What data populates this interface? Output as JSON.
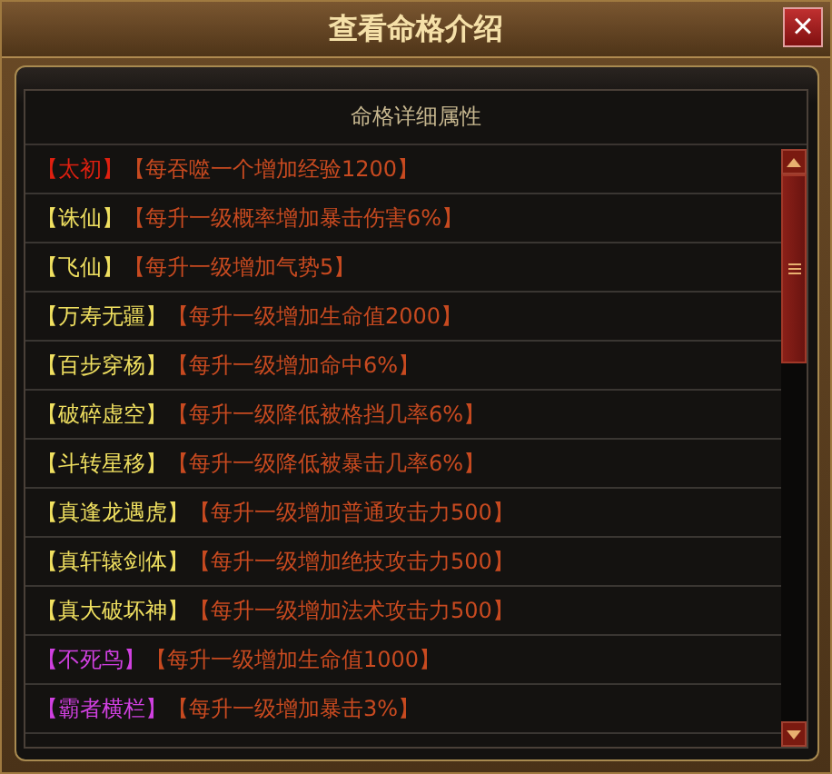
{
  "window": {
    "title": "查看命格介绍",
    "close": "×"
  },
  "panel": {
    "header": "命格详细属性"
  },
  "rows": [
    {
      "name": "【太初】",
      "color": "#e02010",
      "effect": "【每吞噬一个增加经验1200】"
    },
    {
      "name": "【诛仙】",
      "color": "#f0e060",
      "effect": "【每升一级概率增加暴击伤害6%】"
    },
    {
      "name": "【飞仙】",
      "color": "#f0e060",
      "effect": "【每升一级增加气势5】"
    },
    {
      "name": "【万寿无疆】",
      "color": "#f0e060",
      "effect": "【每升一级增加生命值2000】"
    },
    {
      "name": "【百步穿杨】",
      "color": "#f0e060",
      "effect": "【每升一级增加命中6%】"
    },
    {
      "name": "【破碎虚空】",
      "color": "#f0e060",
      "effect": "【每升一级降低被格挡几率6%】"
    },
    {
      "name": "【斗转星移】",
      "color": "#f0e060",
      "effect": "【每升一级降低被暴击几率6%】"
    },
    {
      "name": "【真逢龙遇虎】",
      "color": "#f0e060",
      "effect": "【每升一级增加普通攻击力500】"
    },
    {
      "name": "【真轩辕剑体】",
      "color": "#f0e060",
      "effect": "【每升一级增加绝技攻击力500】"
    },
    {
      "name": "【真大破坏神】",
      "color": "#f0e060",
      "effect": "【每升一级增加法术攻击力500】"
    },
    {
      "name": "【不死鸟】",
      "color": "#d040e0",
      "effect": "【每升一级增加生命值1000】"
    },
    {
      "name": "【霸者横栏】",
      "color": "#d040e0",
      "effect": "【每升一级增加暴击3%】"
    }
  ]
}
